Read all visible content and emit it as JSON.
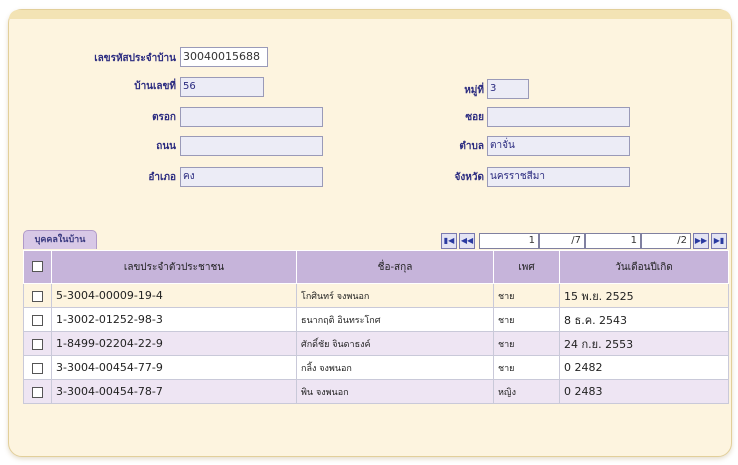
{
  "form": {
    "house_code_label": "เลขรหัสประจำบ้าน",
    "house_code_value": "30040015688",
    "house_no_label": "บ้านเลขที่",
    "house_no_value": "56",
    "moo_label": "หมู่ที่",
    "moo_value": "3",
    "trok_label": "ตรอก",
    "trok_value": "",
    "soi_label": "ซอย",
    "soi_value": "",
    "road_label": "ถนน",
    "road_value": "",
    "tambon_label": "ตำบล",
    "tambon_value": "ตาจั่น",
    "amphoe_label": "อำเภอ",
    "amphoe_value": "คง",
    "province_label": "จังหวัด",
    "province_value": "นครราชสีมา"
  },
  "tab": {
    "label": "บุคคลในบ้าน"
  },
  "pager": {
    "first_icon": "first-page-icon",
    "prev_icon": "prev-page-icon",
    "next_icon": "next-page-icon",
    "last_icon": "last-page-icon",
    "page_current": "1",
    "page_total": "/7",
    "row_current": "1",
    "row_total": "/2"
  },
  "table": {
    "headers": [
      "เลขประจำตัวประชาชน",
      "ชื่อ-สกุล",
      "เพศ",
      "วันเดือนปีเกิด"
    ],
    "rows": [
      [
        "5-3004-00009-19-4",
        "โกศินทร์ จงพนอก",
        "ชาย",
        "15 พ.ย. 2525"
      ],
      [
        "1-3002-01252-98-3",
        "ธนากฤติ อินทระโกศ",
        "ชาย",
        "8 ธ.ค. 2543"
      ],
      [
        "1-8499-02204-22-9",
        "ศักดิ์ชัย จินดาธงค์",
        "ชาย",
        "24 ก.ย. 2553"
      ],
      [
        "3-3004-00454-77-9",
        "กลิ้ง จงพนอก",
        "ชาย",
        "0 2482"
      ],
      [
        "3-3004-00454-78-7",
        "พิน จงพนอก",
        "หญิง",
        "0 2483"
      ]
    ]
  },
  "colors": {
    "panel_bg": "#fdf4df",
    "header_bg": "#c6b4da",
    "label_color": "#2b2b80",
    "field_bg": "#ececf6"
  }
}
